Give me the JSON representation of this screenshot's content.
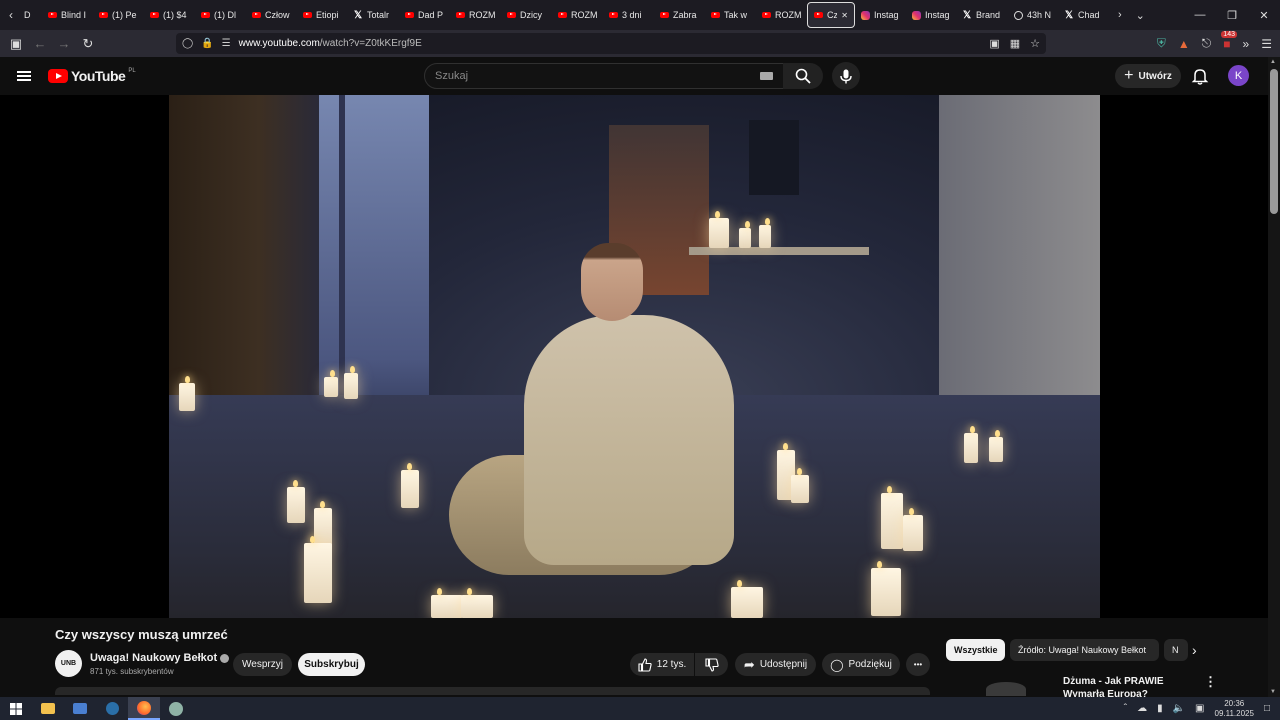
{
  "browser": {
    "tabs": [
      {
        "label": "D",
        "icon": "none"
      },
      {
        "label": "Blind I",
        "icon": "youtube-icon"
      },
      {
        "label": "(1) Pe",
        "icon": "youtube-icon"
      },
      {
        "label": "(1) $4",
        "icon": "youtube-icon"
      },
      {
        "label": "(1) Dl",
        "icon": "youtube-icon"
      },
      {
        "label": "Człow",
        "icon": "youtube-icon"
      },
      {
        "label": "Etiopi",
        "icon": "youtube-icon"
      },
      {
        "label": "Totalr",
        "icon": "x-icon"
      },
      {
        "label": "Dad P",
        "icon": "youtube-icon"
      },
      {
        "label": "ROZM",
        "icon": "youtube-icon"
      },
      {
        "label": "Dzicy",
        "icon": "youtube-icon"
      },
      {
        "label": "ROZM",
        "icon": "youtube-icon"
      },
      {
        "label": "3 dni",
        "icon": "youtube-icon"
      },
      {
        "label": "Zabra",
        "icon": "youtube-icon"
      },
      {
        "label": "Tak w",
        "icon": "youtube-icon"
      },
      {
        "label": "ROZM",
        "icon": "youtube-icon"
      },
      {
        "label": "Czy",
        "icon": "youtube-icon",
        "active": true
      },
      {
        "label": "Instag",
        "icon": "instagram-icon"
      },
      {
        "label": "Instag",
        "icon": "instagram-icon"
      },
      {
        "label": "Brand",
        "icon": "x-icon"
      },
      {
        "label": "43h N",
        "icon": "circle-icon"
      },
      {
        "label": "Chad",
        "icon": "x-icon"
      }
    ],
    "url_host": "www.youtube.com",
    "url_path": "/watch?v=Z0tkKErgf9E",
    "extension_badge": "143"
  },
  "youtube": {
    "logo_text": "YouTube",
    "country_code": "PL",
    "search_placeholder": "Szukaj",
    "create_label": "Utwórz",
    "avatar_letter": "K"
  },
  "video": {
    "title": "Czy wszyscy muszą umrzeć",
    "channel_name": "Uwaga! Naukowy Bełkot",
    "channel_avatar_text": "UNB",
    "subscribers": "871 tys. subskrybentów",
    "support_label": "Wesprzyj",
    "subscribe_label": "Subskrybuj",
    "likes": "12 tys.",
    "share_label": "Udostępnij",
    "thanks_label": "Podziękuj",
    "more_label": "•••"
  },
  "chips": [
    {
      "label": "Wszystkie",
      "selected": true
    },
    {
      "label": "Źródło: Uwaga! Naukowy Bełkot",
      "selected": false
    },
    {
      "label": "N",
      "selected": false
    }
  ],
  "recommendation": {
    "title": "Dżuma - Jak PRAWIE Wymarła Europa?"
  },
  "taskbar": {
    "time": "20:36",
    "date": "09.11.2025"
  },
  "colors": {
    "youtube_red": "#ff0000",
    "avatar": "#7a45c9"
  }
}
